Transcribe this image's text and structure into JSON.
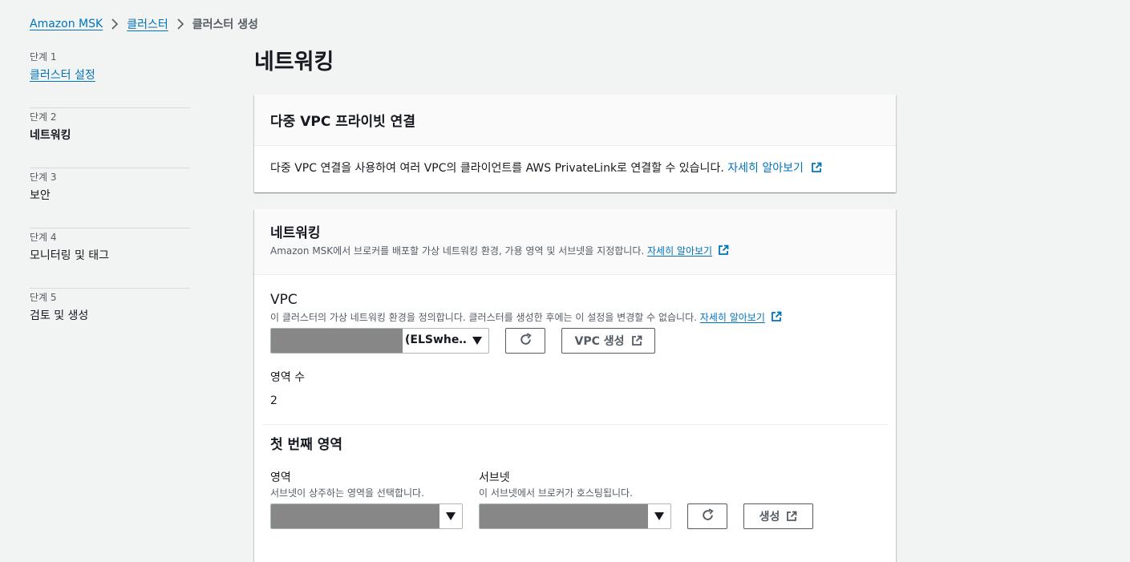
{
  "breadcrumb": {
    "items": [
      "Amazon MSK",
      "클러스터"
    ],
    "current": "클러스터 생성"
  },
  "steps": [
    {
      "num": "단계 1",
      "title": "클러스터 설정"
    },
    {
      "num": "단계 2",
      "title": "네트워킹"
    },
    {
      "num": "단계 3",
      "title": "보안"
    },
    {
      "num": "단계 4",
      "title": "모니터링 및 태그"
    },
    {
      "num": "단계 5",
      "title": "검토 및 생성"
    }
  ],
  "page_title": "네트워킹",
  "multi_vpc": {
    "title": "다중 VPC 프라이빗 연결",
    "body": "다중 VPC 연결을 사용하여 여러 VPC의 클라이언트를 AWS PrivateLink로 연결할 수 있습니다.",
    "learn_more": "자세히 알아보기"
  },
  "networking": {
    "title": "네트워킹",
    "description": "Amazon MSK에서 브로커를 배포할 가상 네트워킹 환경, 가용 영역 및 서브넷을 지정합니다.",
    "learn_more": "자세히 알아보기",
    "vpc": {
      "label": "VPC",
      "description": "이 클러스터의 가상 네트워킹 환경을 정의합니다. 클러스터를 생성한 후에는 이 설정을 변경할 수 없습니다.",
      "learn_more": "자세히 알아보기",
      "selected_value": "(ELSwhe…",
      "create_button": "VPC 생성"
    },
    "zone_count": {
      "label": "영역 수",
      "value": "2"
    },
    "first_zone": {
      "title": "첫 번째 영역",
      "zone_label": "영역",
      "zone_description": "서브넷이 상주하는 영역을 선택합니다.",
      "subnet_label": "서브넷",
      "subnet_description": "이 서브넷에서 브로커가 호스팅됩니다.",
      "create_button": "생성"
    }
  },
  "icons": {
    "breadcrumb_separator": "chevron-right-icon",
    "external": "external-link-icon",
    "refresh": "refresh-icon",
    "dropdown": "caret-down-icon"
  },
  "colors": {
    "link": "#0073bb",
    "background": "#f2f3f3",
    "redacted": "#878787"
  }
}
